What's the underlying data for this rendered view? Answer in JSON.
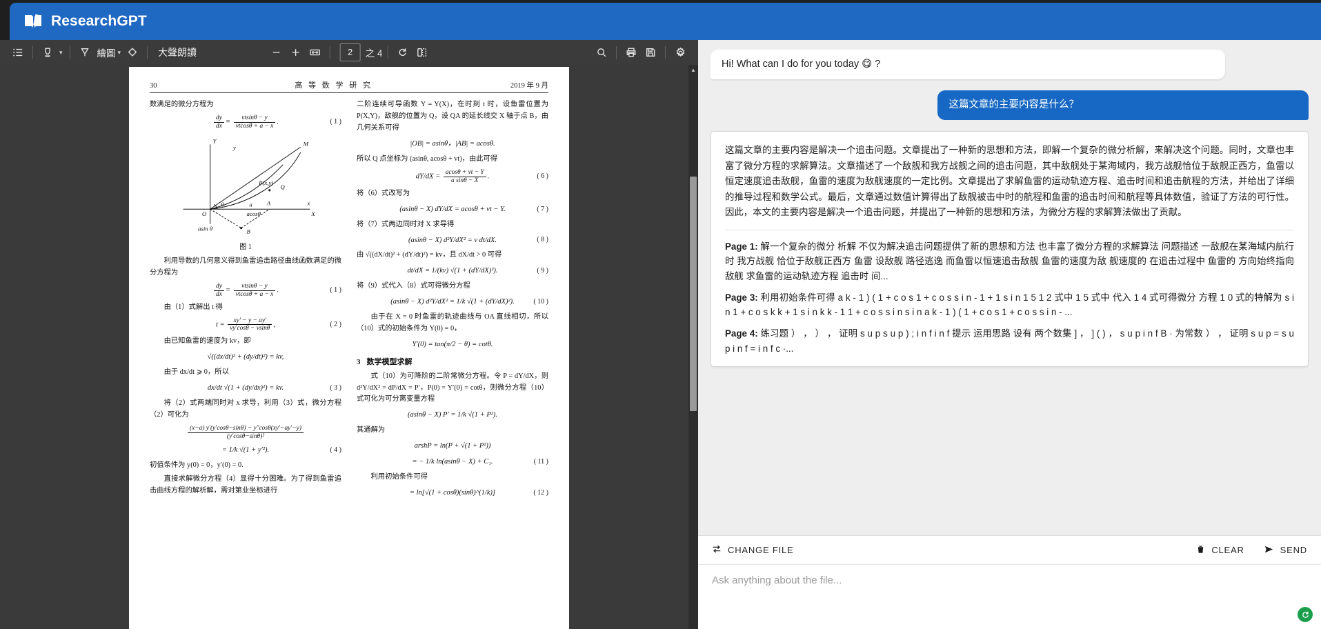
{
  "app": {
    "title": "ResearchGPT",
    "brand_color": "#2069c2",
    "logo_icon": "open-book-icon"
  },
  "pdf_toolbar": {
    "icons": {
      "toc": "list-view-icon",
      "highlight": "highlighter-icon",
      "highlight_caret": "chevron-down-icon",
      "draw": "pen-icon",
      "draw_caret": "chevron-down-icon",
      "erase": "eraser-icon",
      "zoom_out": "minus-icon",
      "zoom_in": "plus-icon",
      "fit_width": "fit-page-icon",
      "rotate": "rotate-icon",
      "layout": "page-layout-icon",
      "search": "search-icon",
      "print": "print-icon",
      "save": "save-icon",
      "settings": "gear-icon"
    },
    "draw_label": "繪圖",
    "read_aloud_label": "大聲朗讀",
    "zoom_out_label": "−",
    "zoom_in_label": "+",
    "page_current": "2",
    "page_of_label": "之 4",
    "total_pages": "4"
  },
  "document": {
    "header": {
      "page_number": "30",
      "journal": "高 等 数 学 研 究",
      "date": "2019 年 9 月"
    },
    "left_column": {
      "p1": "数满足的微分方程为",
      "eq1": {
        "tag": "( 1 )",
        "lhs_num": "dy",
        "lhs_den": "dx",
        "rhs_num": "vtsinθ − y",
        "rhs_den": "vtcosθ + a − x"
      },
      "fig_caption": "图 1",
      "p2": "利用导数的几何意义得到鱼雷追击路径曲线函数满足的微分方程为",
      "eq1b": {
        "tag": "( 1 )",
        "lhs_num": "dy",
        "lhs_den": "dx",
        "rhs_num": "vtsinθ − y",
        "rhs_den": "vtcosθ + a − x"
      },
      "p3": "由（1）式解出 t 得",
      "eq2": {
        "tag": "( 2 )",
        "num": "xy′ − y − ay′",
        "den": "vy′cosθ − vsinθ",
        "lhs": "t ="
      },
      "p4": "由已知鱼雷的速度为 kv，即",
      "eq_speed": "√((dx/dt)² + (dy/dt)²) = kv,",
      "p5": "由于 dx/dt ⩾ 0，所以",
      "eq3": {
        "tag": "( 3 )",
        "body": "dx/dt √(1 + (dy/dx)²) = kv."
      },
      "p6": "将（2）式两端同时对 x 求导，利用（3）式，微分方程（2）可化为",
      "eq4": {
        "tag": "( 4 )",
        "line1": "(x−a) y′(y′cosθ−sinθ) − y″cosθ(xy′−ay′−y)",
        "line1d": "(y′cosθ−sinθ)²",
        "line2": "= 1/k √(1 + y′²)."
      },
      "p7": "初值条件为 y(0) = 0，y′(0) = 0.",
      "p8": "直接求解微分方程（4）显得十分困难。为了得到鱼雷追击曲线方程的解析解，需对第业坐标进行"
    },
    "right_column": {
      "p1": "二阶连续可导函数 Y = Y(X)，在时刻 t 时，设鱼雷位置为 P(X,Y)，敌舰的位置为 Q，设 QA 的延长线交 X 轴于点 B，由几何关系可得",
      "eq_geom": "|OB| = asinθ，|AB| = acosθ.",
      "p2": "所以 Q 点坐标为 (asinθ, acosθ + vt)，由此可得",
      "eq6": {
        "tag": "( 6 )",
        "lhs": "dY/dX =",
        "num": "acosθ + vt − Y",
        "den": "a sinθ − X"
      },
      "p3": "将（6）式改写为",
      "eq7": {
        "tag": "( 7 )",
        "body": "(asinθ − X) dY/dX = acosθ + vt − Y."
      },
      "p4": "将（7）式两边同时对 X 求导得",
      "eq8": {
        "tag": "( 8 )",
        "body": "(asinθ − X) d²Y/dX² = v dt/dX."
      },
      "p5": "由 √((dX/dt)² + (dY/dt)²) = kv，且 dX/dt > 0 可得",
      "eq9": {
        "tag": "( 9 )",
        "body": "dt/dX = 1/(kv) √(1 + (dY/dX)²)."
      },
      "p6": "将（9）式代入（8）式可得微分方程",
      "eq10": {
        "tag": "( 10 )",
        "body": "(asinθ − X) d²Y/dX² = 1/k √(1 + (dY/dX)²)."
      },
      "p7": "由于在 X = 0 时鱼雷的轨迹曲线与 OA 直线相切，所以（10）式的初始条件为 Y(0) = 0，",
      "eq_init": "Y′(0) = tan(π/2 − θ) = cotθ.",
      "section": {
        "number": "3",
        "title": "数学模型求解"
      },
      "p8": "式（10）为可降阶的二阶常微分方程。令 P = dY/dX，则 d²Y/dX² = dP/dX = P′，P(0) = Y′(0) = cotθ，则微分方程（10）式可化为可分离变量方程",
      "eq_sep": "(asinθ − X) P′ = 1/k √(1 + P²).",
      "p9": "其通解为",
      "eq11": {
        "tag": "( 11 )",
        "line1": "arshP = ln(P + √(1 + P²))",
        "line2": "= − 1/k ln(asinθ − X) + C₁."
      },
      "p10": "利用初始条件可得",
      "eq12": {
        "tag": "( 12 )",
        "body": "= ln[√(1 + cosθ)(sinθ)^(1/k)]"
      }
    }
  },
  "chat": {
    "greeting": "Hi! What can I do for you today 😋 ?",
    "user_question": "这篇文章的主要内容是什么？",
    "answer_summary": "这篇文章的主要内容是解决一个追击问题。文章提出了一种新的思想和方法，即解一个复杂的微分析解，来解决这个问题。同时，文章也丰富了微分方程的求解算法。文章描述了一个敌舰和我方战舰之间的追击问题，其中敌舰处于某海域内，我方战舰恰位于敌舰正西方，鱼雷以恒定速度追击敌舰，鱼雷的速度为敌舰速度的一定比例。文章提出了求解鱼雷的运动轨迹方程、追击时间和追击航程的方法，并给出了详细的推导过程和数学公式。最后，文章通过数值计算得出了敌舰被击中时的航程和鱼雷的追击时间和航程等具体数值，验证了方法的可行性。因此，本文的主要内容是解决一个追击问题，并提出了一种新的思想和方法，为微分方程的求解算法做出了贡献。",
    "citations": [
      {
        "label": "Page 1:",
        "text": "解一个复杂的微分 析解 不仅为解决追击问题提供了新的思想和方法 也丰富了微分方程的求解算法 问题描述 一敌舰在某海域内航行时 我方战舰 恰位于敌舰正西方 鱼雷 设敌舰 路径逃逸 而鱼雷以恒速追击敌舰 鱼雷的速度为敌 舰速度的 在追击过程中 鱼雷的 方向始终指向敌舰 求鱼雷的运动轨迹方程 追击时 间..."
      },
      {
        "label": "Page 3:",
        "text": "利用初始条件可得 a k - 1 ) ( 1 + c o s 1 + c o s s i n - 1 + 1 s i n 1 5 1 2 式中 1 5 式中 代入 1 4 式可得微分 方程 1 0 式的特解为 s i n 1 + c o s k k + 1 s i n k k - 1 1 + c o s s i n s i n a k - 1 ) ( 1 + c o s 1 + c o s s i n - ..."
      },
      {
        "label": "Page 4:",
        "text": "练习题 ） ， ） ， 证明 s u p s u p ) ; i n f i n f 提示 运用思路 设有 两个数集 ] ， ] ( ) ， s u p i n f B · 为常数 ） ， 证明 s u p = s u p i n f = i n f c ·..."
      }
    ],
    "composer": {
      "change_file_label": "CHANGE FILE",
      "change_file_icon": "swap-icon",
      "clear_label": "CLEAR",
      "clear_icon": "trash-icon",
      "send_label": "SEND",
      "send_icon": "send-icon",
      "input_value": "",
      "input_placeholder": "Ask anything about the file..."
    },
    "fab_icon": "refresh-icon",
    "fab_color": "#1a9e4b"
  }
}
